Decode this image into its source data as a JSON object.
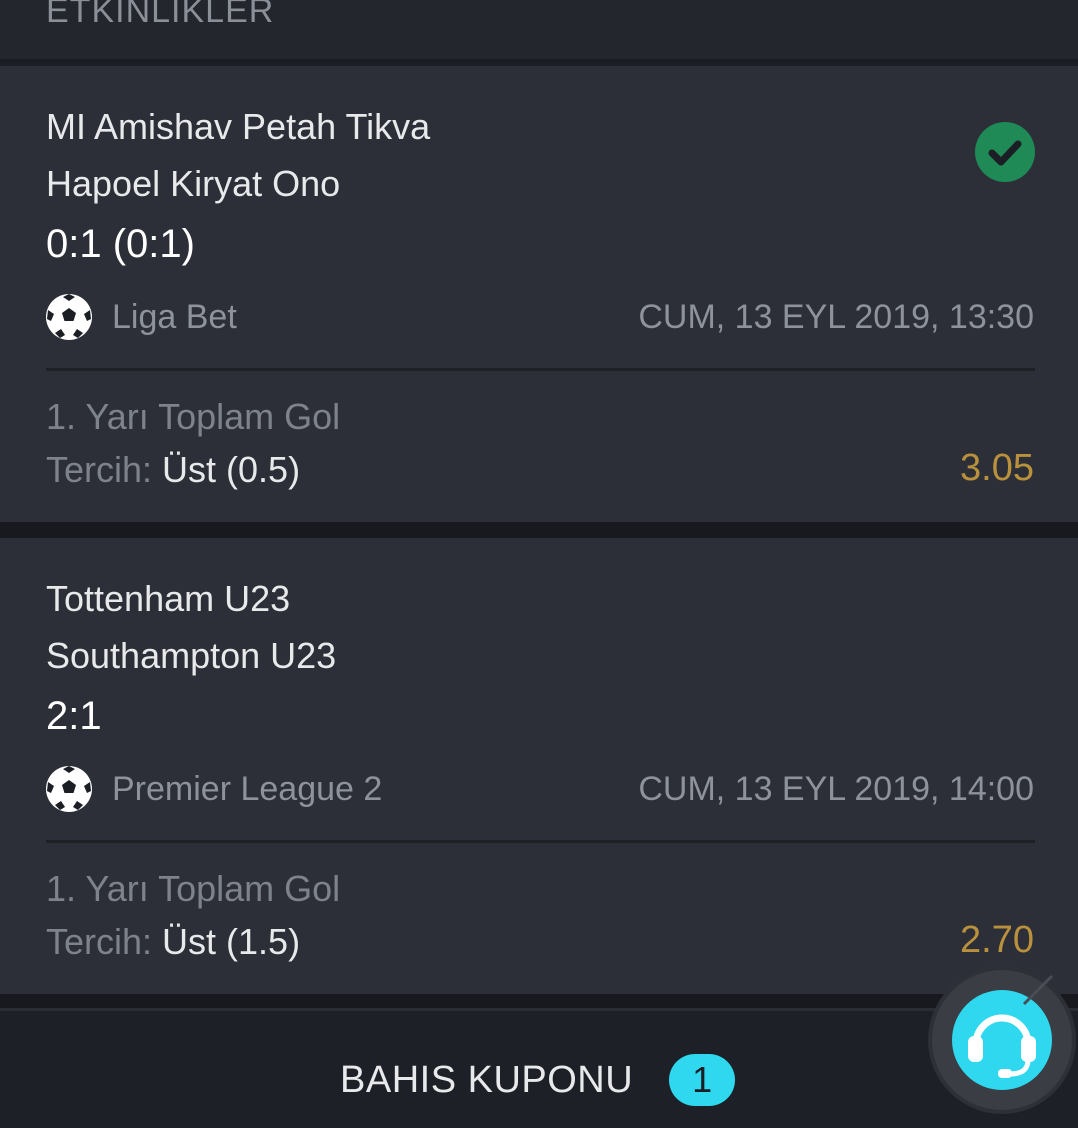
{
  "section": {
    "title": "ETKINLIKLER"
  },
  "events": [
    {
      "home_team": "MI Amishav Petah Tikva",
      "away_team": "Hapoel Kiryat Ono",
      "score": "0:1 (0:1)",
      "status_icon": "check-circle-icon",
      "sport_icon": "soccer-ball-icon",
      "league": "Liga Bet",
      "datetime": "CUM, 13 EYL 2019, 13:30",
      "market": "1. Yarı Toplam Gol",
      "pref_label": "Tercih:",
      "pref_value": "Üst (0.5)",
      "odds": "3.05"
    },
    {
      "home_team": "Tottenham U23",
      "away_team": "Southampton U23",
      "score": "2:1",
      "sport_icon": "soccer-ball-icon",
      "league": "Premier League 2",
      "datetime": "CUM, 13 EYL 2019, 14:00",
      "market": "1. Yarı Toplam Gol",
      "pref_label": "Tercih:",
      "pref_value": "Üst (1.5)",
      "odds": "2.70"
    }
  ],
  "bottom_bar": {
    "coupon_label": "BAHIS KUPONU",
    "coupon_count": "1"
  },
  "support": {
    "icon": "headset-icon"
  },
  "colors": {
    "odds": "#b9913c",
    "win": "#1f8a55",
    "badge": "#2fd8ee",
    "support": "#2fd8ee",
    "card": "#2c2f38"
  }
}
